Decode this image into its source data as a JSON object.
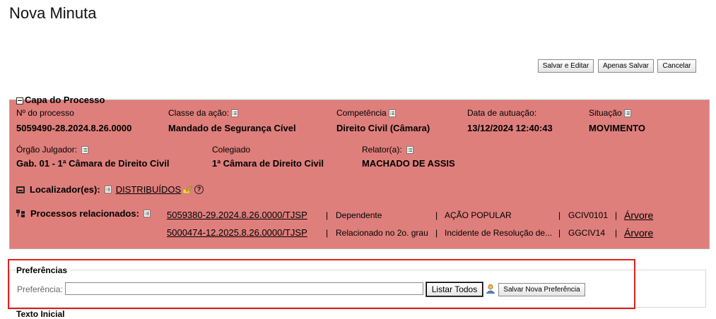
{
  "page": {
    "title": "Nova Minuta"
  },
  "toolbar": {
    "salvar_editar": "Salvar e Editar",
    "apenas_salvar": "Apenas Salvar",
    "cancelar": "Cancelar"
  },
  "capa": {
    "legend": "Capa do Processo",
    "processo": {
      "label": "Nº do processo",
      "value": "5059490-28.2024.8.26.0000"
    },
    "classe": {
      "label": "Classe da ação:",
      "value": "Mandado de Segurança Cível"
    },
    "competencia": {
      "label": "Competência",
      "value": "Direito Civil (Câmara)"
    },
    "data_autuacao": {
      "label": "Data de autuação:",
      "value": "13/12/2024 12:40:43"
    },
    "situacao": {
      "label": "Situação",
      "value": "MOVIMENTO"
    },
    "orgao": {
      "label": "Órgão Julgador:",
      "value": "Gab. 01 - 1ª Câmara de Direito Civil"
    },
    "colegiado": {
      "label": "Colegiado",
      "value": "1ª Câmara de Direito Civil"
    },
    "relator": {
      "label": "Relator(a):",
      "value": "MACHADO DE ASSIS"
    },
    "localizador": {
      "label": "Localizador(es):",
      "value": "DISTRIBUÍDOS"
    },
    "relacionados": {
      "label": "Processos relacionados:",
      "rows": [
        {
          "numero": "5059380-29.2024.8.26.0000/TJSP",
          "tipo": "Dependente",
          "classe": "AÇÃO POPULAR",
          "orgao": "GCIV0101",
          "arvore": "Árvore"
        },
        {
          "numero": "5000474-12.2025.8.26.0000/TJSP",
          "tipo": "Relacionado no 2o. grau",
          "classe": "Incidente de Resolução de...",
          "orgao": "GGCIV14",
          "arvore": "Árvore"
        }
      ],
      "separator": "|"
    }
  },
  "preferencias": {
    "legend": "Preferências",
    "label": "Preferência:",
    "input_value": "",
    "listar_todos": "Listar Todos",
    "salvar_nova": "Salvar Nova Preferência"
  },
  "texto_inicial": {
    "legend": "Texto Inicial"
  },
  "colors": {
    "capa_bg": "#de7f7c",
    "highlight": "#e02020"
  }
}
